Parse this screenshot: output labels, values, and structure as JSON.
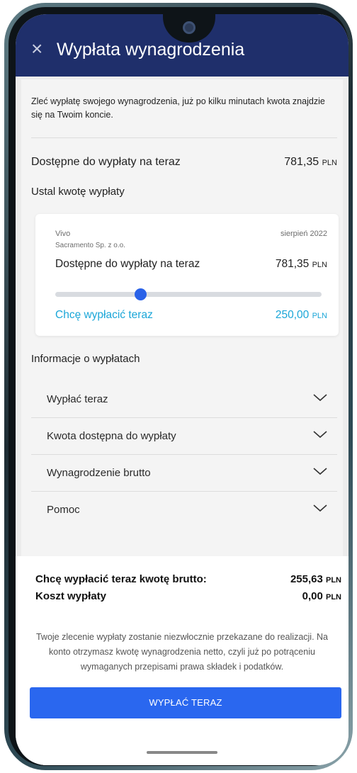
{
  "header": {
    "title": "Wypłata wynagrodzenia",
    "close_glyph": "×"
  },
  "intro": "Zleć wypłatę swojego wynagrodzenia, już po kilku minutach kwota znajdzie się na Twoim koncie.",
  "available": {
    "label": "Dostępne do wypłaty na teraz",
    "amount": "781,35",
    "unit": "PLN"
  },
  "set_amount_label": "Ustal kwotę wypłaty",
  "card": {
    "employer": "Vivo",
    "company": "Sacramento Sp. z o.o.",
    "period": "sierpień 2022",
    "available_label": "Dostępne do wypłaty na teraz",
    "available_amount": "781,35",
    "available_unit": "PLN",
    "slider_fraction": 0.32,
    "want_label": "Chcę wypłacić teraz",
    "want_amount": "250,00",
    "want_unit": "PLN"
  },
  "info_heading": "Informacje o wypłatach",
  "accordion": [
    {
      "label": "Wypłać teraz"
    },
    {
      "label": "Kwota dostępna do wypłaty"
    },
    {
      "label": "Wynagrodzenie brutto"
    },
    {
      "label": "Pomoc"
    }
  ],
  "footer": {
    "gross_label": "Chcę wypłacić teraz kwotę brutto:",
    "gross_amount": "255,63",
    "gross_unit": "PLN",
    "cost_label": "Koszt wypłaty",
    "cost_amount": "0,00",
    "cost_unit": "PLN",
    "note": "Twoje zlecenie wypłaty zostanie niezwłocznie przekazane do realizacji. Na konto otrzymasz kwotę wynagrodzenia netto, czyli już po potrąceniu wymaganych przepisami prawa składek i podatków.",
    "button_label": "WYPŁAĆ TERAZ"
  },
  "colors": {
    "header_bg": "#1f2f6b",
    "accent_blue": "#2a62e8",
    "accent_cyan": "#1aa6d8"
  }
}
